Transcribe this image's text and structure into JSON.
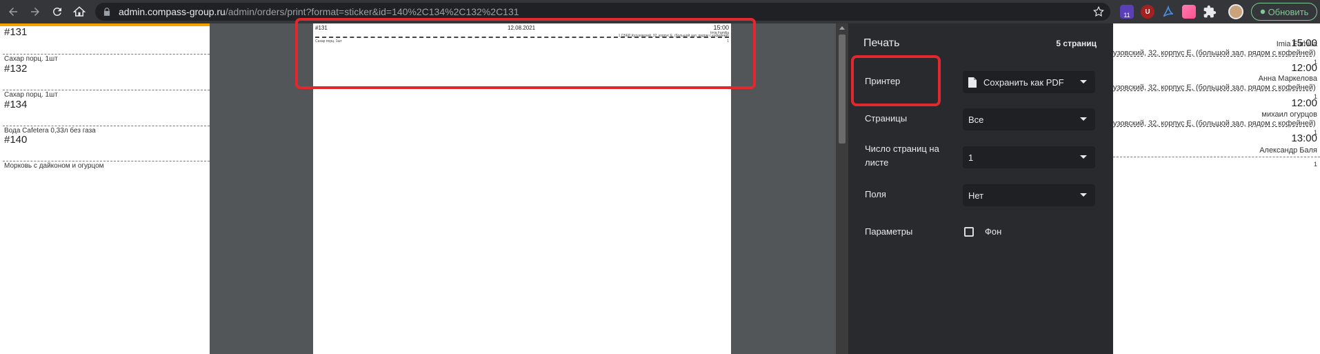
{
  "browser": {
    "url_host": "admin.compass-group.ru",
    "url_path": "/admin/orders/print?format=sticker&id=140%2C134%2C132%2C131",
    "update_label": "Обновить",
    "ext_badge": "11",
    "ext_u_label": "U"
  },
  "orders_left": [
    {
      "number": "#131",
      "item": "Сахар порц. 1шт"
    },
    {
      "number": "#132",
      "item": "Сахар порц. 1шт"
    },
    {
      "number": "#134",
      "item": "Вода Cafetera 0,33л без газа"
    },
    {
      "number": "#140",
      "item": "Морковь с дайконом и огурцом"
    }
  ],
  "orders_right": [
    {
      "time": "15:00",
      "name": "Imia Familia",
      "address": "узовский, 32, корпус Е, (большой зал, рядом с кофейней)",
      "qty": "1"
    },
    {
      "time": "12:00",
      "name": "Анна Маркелова",
      "address": "узовский, 32, корпус Е, (большой зал, рядом с кофейней)",
      "qty": "1"
    },
    {
      "time": "12:00",
      "name": "михаил огурцов",
      "address": "узовский, 32, корпус Е, (большой зал, рядом с кофейней)",
      "qty": "1"
    },
    {
      "time": "13:00",
      "name": "Александр Баля",
      "address": "",
      "qty": "1"
    }
  ],
  "preview_sheet": {
    "id": "#131",
    "date": "12.08.2021",
    "time": "15:00",
    "name": "Imia Familia",
    "address": "1 СБЕР Кутузовский, 32, корпус Е, (большой зал, рядом с кофейней)",
    "item": "Сахар порц. 1шт",
    "qty": "1"
  },
  "dialog": {
    "title": "Печать",
    "page_count": "5 страниц",
    "printer_label": "Принтер",
    "printer_value": "Сохранить как PDF",
    "pages_label": "Страницы",
    "pages_value": "Все",
    "per_sheet_label": "Число страниц на листе",
    "per_sheet_value": "1",
    "margins_label": "Поля",
    "margins_value": "Нет",
    "options_label": "Параметры",
    "background_label": "Фон",
    "background_checked": false
  }
}
